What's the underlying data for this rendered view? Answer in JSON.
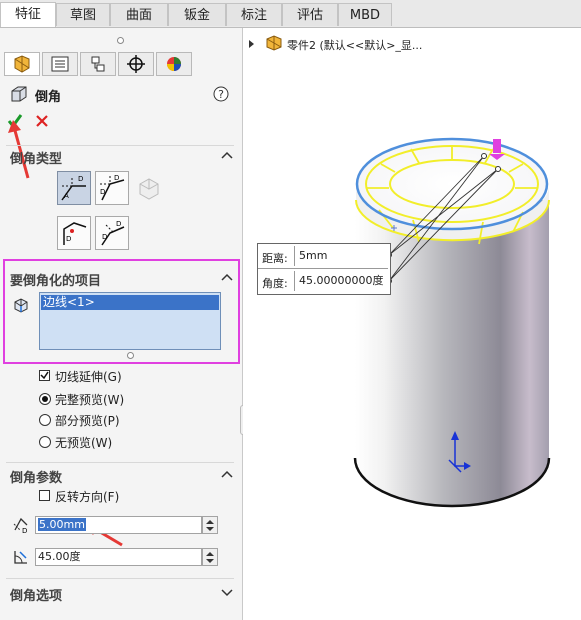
{
  "tabs": [
    "特征",
    "草图",
    "曲面",
    "钣金",
    "标注",
    "评估",
    "MBD"
  ],
  "panel": {
    "title": "倒角",
    "sections": {
      "chamfer_type": "倒角类型",
      "items_to_chamfer": "要倒角化的项目",
      "chamfer_params": "倒角参数",
      "chamfer_options": "倒角选项"
    },
    "selected_edge": "边线<1>",
    "tangent_propagation": "切线延伸(G)",
    "preview": {
      "full": "完整预览(W)",
      "partial": "部分预览(P)",
      "none": "无预览(W)"
    },
    "flip_direction": "反转方向(F)",
    "distance_value": "5.00mm",
    "angle_value": "45.00度"
  },
  "tree": {
    "part_label": "零件2 (默认<<默认>_显..."
  },
  "callout": {
    "distance_label": "距离:",
    "distance_value": "5mm",
    "angle_label": "角度:",
    "angle_value": "45.00000000度"
  },
  "colors": {
    "accent_pink": "#e040e0",
    "annotation_red": "#e53935",
    "edge_yellow": "#f2ee2a",
    "edge_blue": "#4f8fdc"
  }
}
